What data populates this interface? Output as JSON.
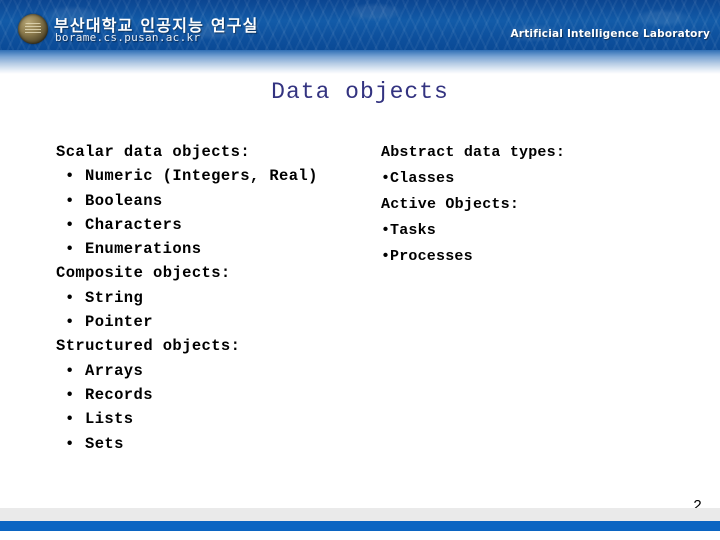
{
  "header": {
    "seal_icon": "university-seal-icon",
    "org_name_kr": "부산대학교 인공지능 연구실",
    "org_url": "borame.cs.pusan.ac.kr",
    "lab_name_en": "Artificial Intelligence Laboratory",
    "background_color": "#0d4f9c"
  },
  "slide": {
    "title": "Data objects",
    "title_color": "#333380",
    "page_number": "2"
  },
  "content": {
    "left_column": [
      {
        "type": "heading",
        "text": "Scalar data objects:"
      },
      {
        "type": "bullet",
        "text": "Numeric (Integers, Real)"
      },
      {
        "type": "bullet",
        "text": "Booleans"
      },
      {
        "type": "bullet",
        "text": "Characters"
      },
      {
        "type": "bullet",
        "text": "Enumerations"
      },
      {
        "type": "heading",
        "text": "Composite objects:"
      },
      {
        "type": "bullet",
        "text": "String"
      },
      {
        "type": "bullet",
        "text": "Pointer"
      },
      {
        "type": "heading",
        "text": "Structured objects:"
      },
      {
        "type": "bullet",
        "text": "Arrays"
      },
      {
        "type": "bullet",
        "text": "Records"
      },
      {
        "type": "bullet",
        "text": "Lists"
      },
      {
        "type": "bullet",
        "text": "Sets"
      }
    ],
    "right_column": [
      {
        "type": "heading",
        "text": "Abstract data types:"
      },
      {
        "type": "bullet",
        "text": "Classes"
      },
      {
        "type": "heading",
        "text": "Active Objects:"
      },
      {
        "type": "bullet",
        "text": "Tasks"
      },
      {
        "type": "bullet",
        "text": "Processes"
      }
    ],
    "bullet_glyph": "•"
  },
  "footer": {
    "gray_band_color": "#eaeaea",
    "blue_band_color": "#0b65c2"
  }
}
